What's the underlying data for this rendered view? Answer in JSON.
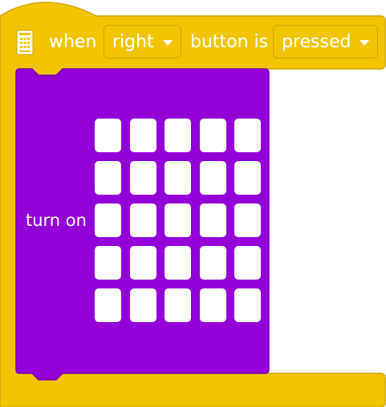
{
  "colors": {
    "hat_block": "#f2c500",
    "hat_border": "#d1a300",
    "command_block": "#9400d8",
    "command_border": "#7a00b2",
    "led_off": "#ffffff",
    "text": "#ffffff"
  },
  "hat_block": {
    "icon": "microbit-board-icon",
    "label_when": "when",
    "button_dropdown": "right",
    "label_button_is": "button is",
    "state_dropdown": "pressed"
  },
  "command_block": {
    "label": "turn on",
    "matrix": {
      "rows": 5,
      "columns": 5,
      "lit_leds": 0
    }
  }
}
